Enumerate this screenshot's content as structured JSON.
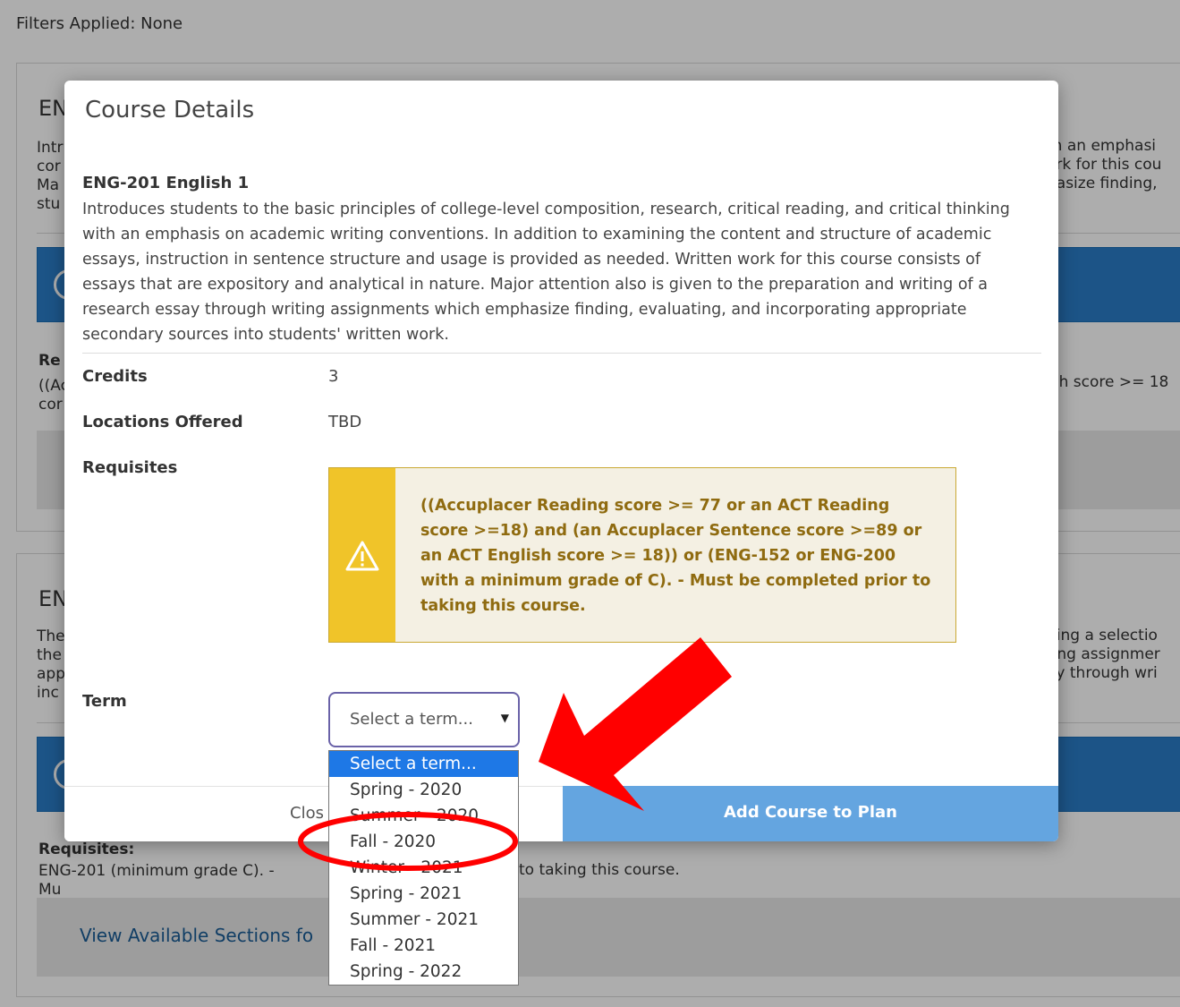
{
  "background": {
    "filters": "Filters Applied: None",
    "card1": {
      "title": "EN",
      "desc": "Intr\ncor\nMa\nstu",
      "right_desc": "th an emphasi\nork for this cou\nhasize finding,",
      "req_label": "Re",
      "req_text": "((Ac\ncor",
      "req_right": "ish score >= 18"
    },
    "card2": {
      "title": "EN",
      "desc": "The\nthe\napp\ninc",
      "right_desc": "ding a selectio\nting assignmer\nay through wri",
      "req_label": "Requisites:",
      "req_text": "ENG-201 (minimum grade C). - Mu",
      "req_text_right": "to taking this course.",
      "link": "View Available Sections fo"
    }
  },
  "modal": {
    "title": "Course Details",
    "course_name": "ENG-201 English 1",
    "description": "Introduces students to the basic principles of college-level composition, research, critical reading, and critical thinking with an emphasis on academic writing conventions. In addition to examining the content and structure of academic essays, instruction in sentence structure and usage is provided as needed. Written work for this course consists of essays that are expository and analytical in nature. Major attention also is given to the preparation and writing of a research essay through writing assignments which emphasize finding, evaluating, and incorporating appropriate secondary sources into students' written work.",
    "credits_label": "Credits",
    "credits_value": "3",
    "locations_label": "Locations Offered",
    "locations_value": "TBD",
    "requisites_label": "Requisites",
    "requisites_text": "((Accuplacer Reading score >= 77 or an ACT Reading score >=18) and (an Accuplacer Sentence score >=89 or an ACT English score >= 18)) or (ENG-152 or ENG-200 with a minimum grade of C). - Must be completed prior to taking this course.",
    "term_label": "Term",
    "term_placeholder": "Select a term...",
    "close_label": "Clos",
    "add_label": "Add Course to Plan"
  },
  "term_options": [
    "Select a term...",
    "Spring - 2020",
    "Summer - 2020",
    "Fall - 2020",
    "Winter - 2021",
    "Spring - 2021",
    "Summer - 2021",
    "Fall - 2021",
    "Spring - 2022"
  ],
  "selected_option_index": 0,
  "colors": {
    "warning_stripe": "#f0c429",
    "warning_text": "#8f6b10",
    "primary_button": "#64a5e0",
    "selected_option": "#1e78e6",
    "annotation_red": "#ff0000"
  }
}
